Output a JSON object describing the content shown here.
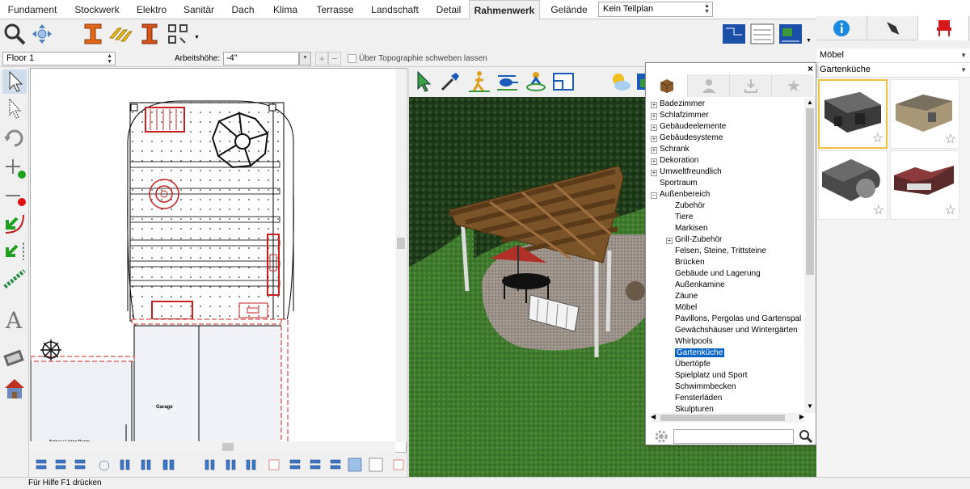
{
  "tabs": [
    "Fundament",
    "Stockwerk",
    "Elektro",
    "Sanitär",
    "Dach",
    "Klima",
    "Terrasse",
    "Landschaft",
    "Detail",
    "Rahmenwerk",
    "Gelände"
  ],
  "active_tab": "Rahmenwerk",
  "teilplan": "Kein Teilplan",
  "floor": "Floor 1",
  "arbeitshoehe_label": "Arbeitshöhe:",
  "arbeitshoehe_value": "-4\"",
  "topo_label": "Über Topographie schweben lassen",
  "plan": {
    "garage_label": "Garage",
    "room_label": "Seiour / Living Room"
  },
  "library": {
    "tree": [
      {
        "label": "Badezimmer",
        "expander": "+",
        "sel": false
      },
      {
        "label": "Schlafzimmer",
        "expander": "+",
        "sel": false
      },
      {
        "label": "Gebäudeelemente",
        "expander": "+",
        "sel": false
      },
      {
        "label": "Gebäudesysteme",
        "expander": "+",
        "sel": false
      },
      {
        "label": "Schrank",
        "expander": "+",
        "sel": false
      },
      {
        "label": "Dekoration",
        "expander": "+",
        "sel": false
      },
      {
        "label": "Umweltfreundlich",
        "expander": "+",
        "sel": false
      },
      {
        "label": "Sportraum",
        "expander": "",
        "sel": false
      },
      {
        "label": "Außenbereich",
        "expander": "−",
        "sel": false
      },
      {
        "label": "Zubehör",
        "expander": "",
        "sel": false
      },
      {
        "label": "Tiere",
        "expander": "",
        "sel": false
      },
      {
        "label": "Markisen",
        "expander": "",
        "sel": false
      },
      {
        "label": "Grill-Zubehör",
        "expander": "+",
        "sel": false
      },
      {
        "label": "Felsen, Steine, Trittsteine",
        "expander": "",
        "sel": false
      },
      {
        "label": "Brücken",
        "expander": "",
        "sel": false
      },
      {
        "label": "Gebäude und Lagerung",
        "expander": "",
        "sel": false
      },
      {
        "label": "Außenkamine",
        "expander": "",
        "sel": false
      },
      {
        "label": "Zäune",
        "expander": "",
        "sel": false
      },
      {
        "label": "Möbel",
        "expander": "",
        "sel": false
      },
      {
        "label": "Pavillons, Pergolas und Gartenspal",
        "expander": "",
        "sel": false
      },
      {
        "label": "Gewächshäuser und Wintergärten",
        "expander": "",
        "sel": false
      },
      {
        "label": "Whirlpools",
        "expander": "",
        "sel": false
      },
      {
        "label": "Gartenküche",
        "expander": "",
        "sel": true
      },
      {
        "label": "Übertöpfe",
        "expander": "",
        "sel": false
      },
      {
        "label": "Spielplatz und Sport",
        "expander": "",
        "sel": false
      },
      {
        "label": "Schwimmbecken",
        "expander": "",
        "sel": false
      },
      {
        "label": "Fensterläden",
        "expander": "",
        "sel": false
      },
      {
        "label": "Skulpturen",
        "expander": "",
        "sel": false
      }
    ]
  },
  "right_panel": {
    "category": "Möbel",
    "subcategory": "Gartenküche",
    "items": [
      "outdoor-kitchen-1",
      "outdoor-kitchen-2",
      "outdoor-kitchen-3",
      "outdoor-kitchen-4"
    ]
  },
  "status": "Für Hilfe F1 drücken",
  "colors": {
    "accent": "#0a64c8",
    "grass": "#3f7a2e",
    "wood": "#7a5428",
    "plan_red": "#c82020"
  }
}
